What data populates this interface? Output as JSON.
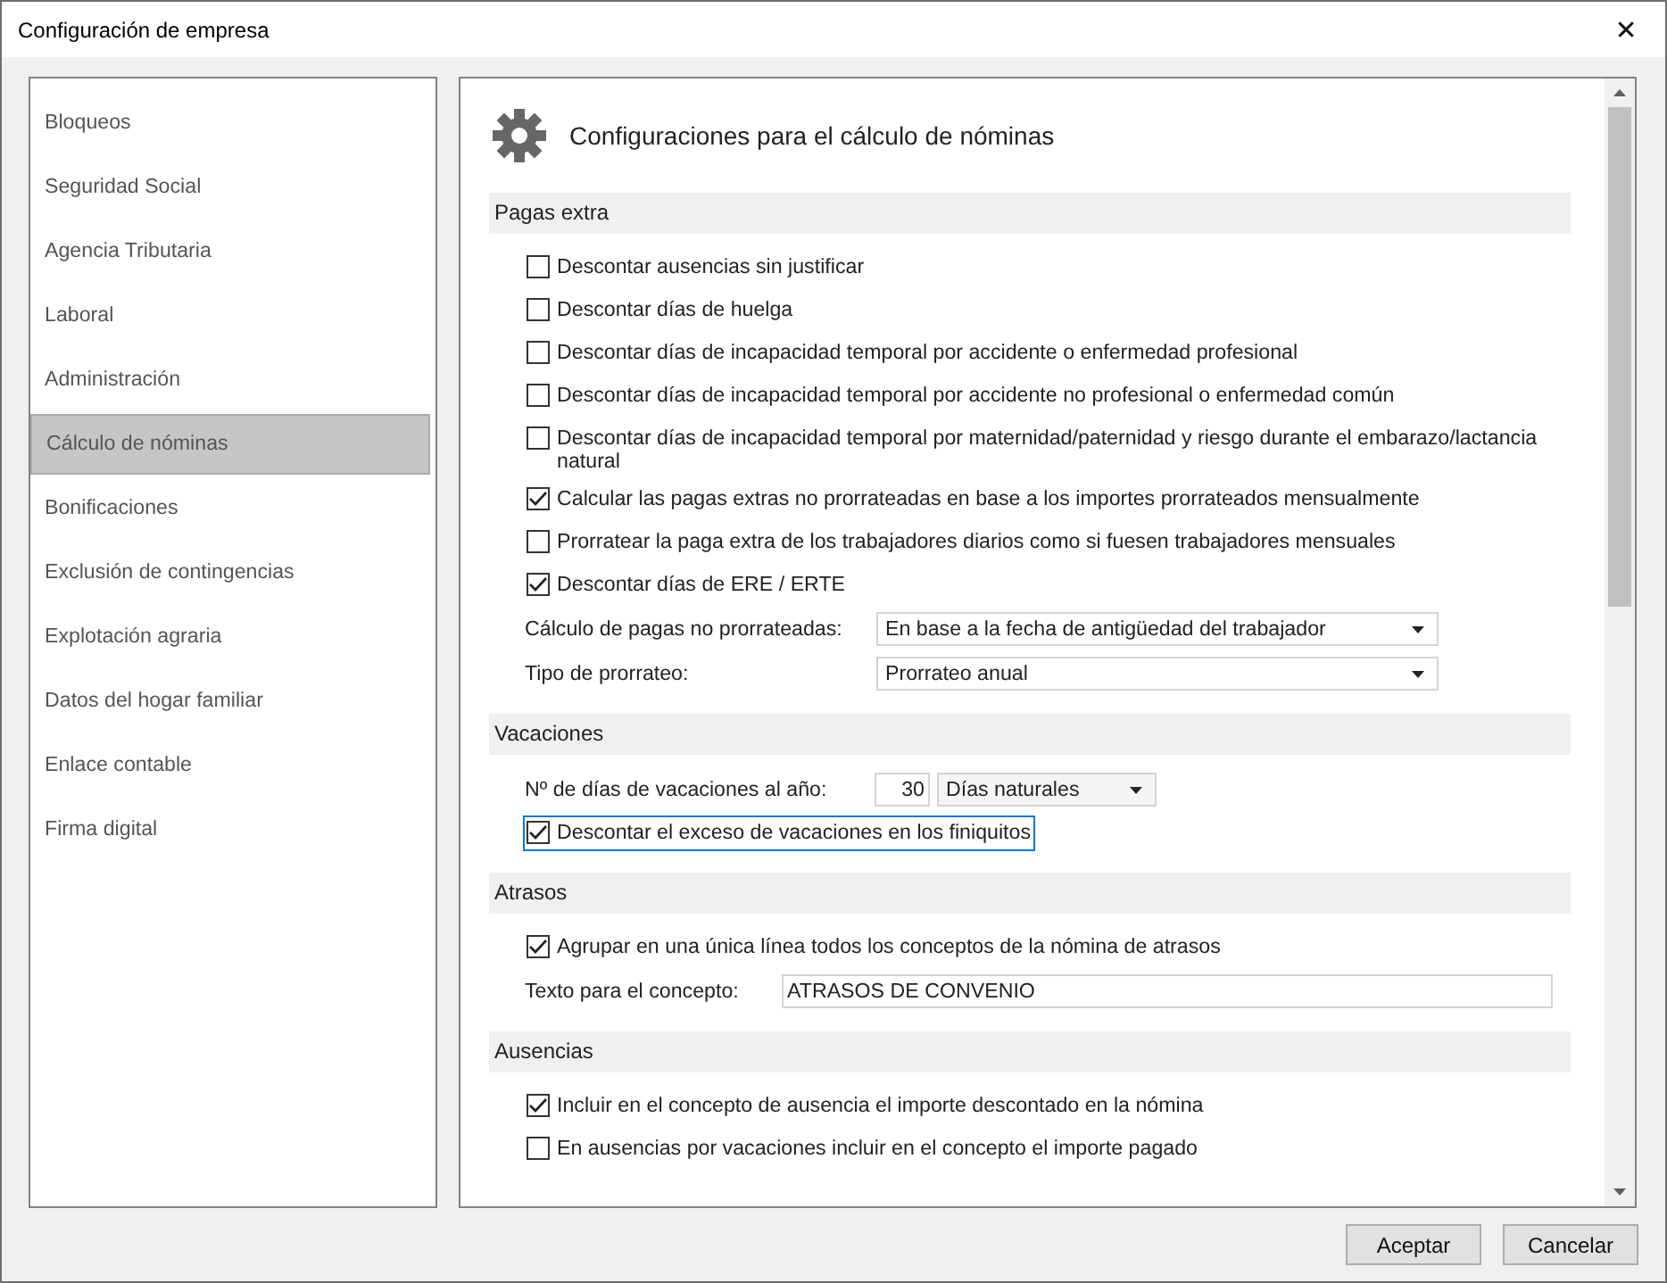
{
  "window": {
    "title": "Configuración de empresa",
    "close": "✕"
  },
  "sidebar": {
    "items": [
      {
        "label": "Bloqueos",
        "selected": false
      },
      {
        "label": "Seguridad Social",
        "selected": false
      },
      {
        "label": "Agencia Tributaria",
        "selected": false
      },
      {
        "label": "Laboral",
        "selected": false
      },
      {
        "label": "Administración",
        "selected": false
      },
      {
        "label": "Cálculo de nóminas",
        "selected": true
      },
      {
        "label": "Bonificaciones",
        "selected": false
      },
      {
        "label": "Exclusión de contingencias",
        "selected": false
      },
      {
        "label": "Explotación agraria",
        "selected": false
      },
      {
        "label": "Datos del hogar familiar",
        "selected": false
      },
      {
        "label": "Enlace contable",
        "selected": false
      },
      {
        "label": "Firma digital",
        "selected": false
      }
    ]
  },
  "panel": {
    "title": "Configuraciones para el cálculo de nóminas",
    "sections": [
      {
        "title": "Pagas extra",
        "items": [
          {
            "kind": "checkbox",
            "label": "Descontar ausencias sin justificar",
            "checked": false,
            "focused": false
          },
          {
            "kind": "checkbox",
            "label": "Descontar días de huelga",
            "checked": false,
            "focused": false
          },
          {
            "kind": "checkbox",
            "label": "Descontar días de incapacidad temporal por accidente o enfermedad profesional",
            "checked": false,
            "focused": false
          },
          {
            "kind": "checkbox",
            "label": "Descontar días de incapacidad temporal por accidente no profesional o enfermedad común",
            "checked": false,
            "focused": false
          },
          {
            "kind": "checkbox",
            "label": "Descontar días de incapacidad temporal por maternidad/paternidad y riesgo durante el embarazo/lactancia natural",
            "checked": false,
            "focused": false
          },
          {
            "kind": "checkbox",
            "label": "Calcular las pagas extras no prorrateadas en base a los importes prorrateados mensualmente",
            "checked": true,
            "focused": false
          },
          {
            "kind": "checkbox",
            "label": "Prorratear la paga extra de los trabajadores diarios como si fuesen trabajadores mensuales",
            "checked": false,
            "focused": false
          },
          {
            "kind": "checkbox",
            "label": "Descontar días de ERE / ERTE",
            "checked": true,
            "focused": false
          },
          {
            "kind": "select",
            "label": "Cálculo de pagas no prorrateadas:",
            "value": "En base a la fecha de antigüedad del trabajador"
          },
          {
            "kind": "select",
            "label": "Tipo de prorrateo:",
            "value": "Prorrateo anual"
          }
        ]
      },
      {
        "title": "Vacaciones",
        "items": [
          {
            "kind": "number",
            "label": "Nº de días de vacaciones al año:",
            "value": "30",
            "unit": "Días naturales"
          },
          {
            "kind": "checkbox",
            "label": "Descontar el exceso de vacaciones en los finiquitos",
            "checked": true,
            "focused": true
          }
        ]
      },
      {
        "title": "Atrasos",
        "items": [
          {
            "kind": "checkbox",
            "label": "Agrupar en una única línea todos los conceptos de la nómina de atrasos",
            "checked": true,
            "focused": false
          },
          {
            "kind": "text",
            "label": "Texto para el concepto:",
            "value": "ATRASOS DE CONVENIO"
          }
        ]
      },
      {
        "title": "Ausencias",
        "items": [
          {
            "kind": "checkbox",
            "label": "Incluir en el concepto de ausencia el importe descontado en la nómina",
            "checked": true,
            "focused": false
          },
          {
            "kind": "checkbox",
            "label": "En ausencias por vacaciones incluir en el concepto el importe pagado",
            "checked": false,
            "focused": false
          }
        ]
      }
    ]
  },
  "buttons": [
    "Aceptar",
    "Cancelar"
  ]
}
